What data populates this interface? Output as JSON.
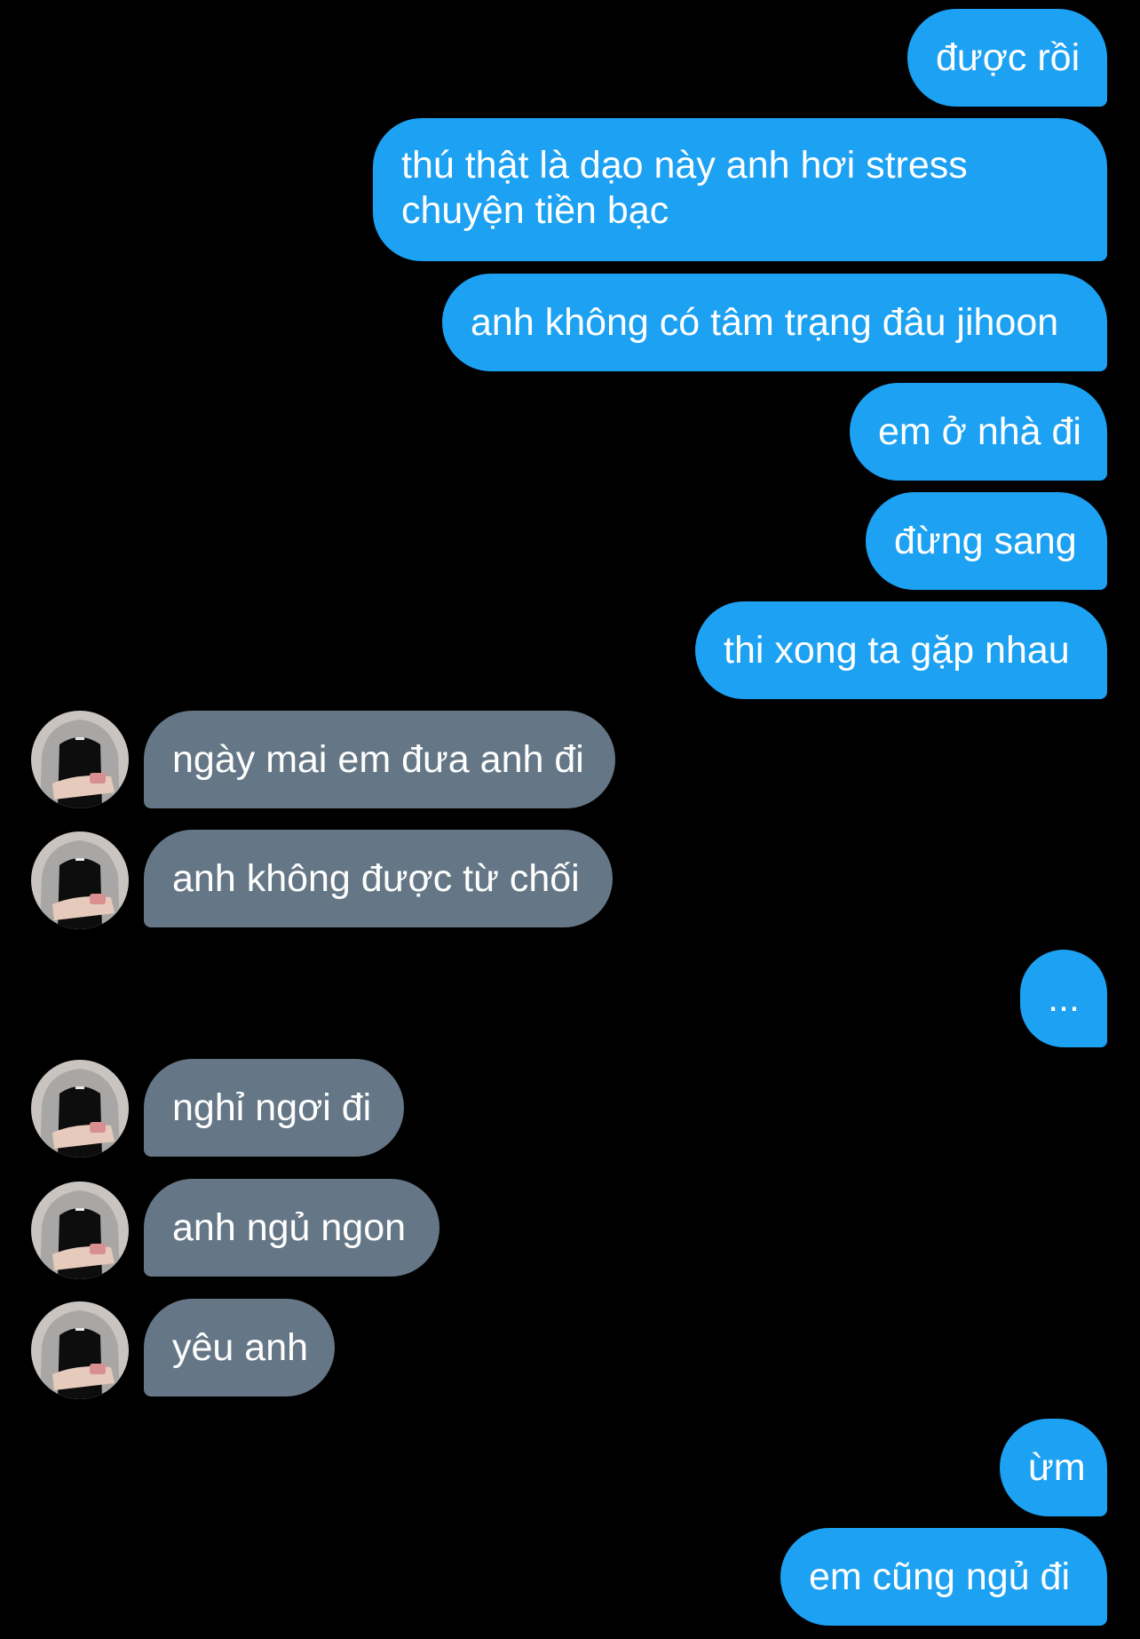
{
  "conversation": {
    "messages": [
      {
        "side": "out",
        "text": "được rồi"
      },
      {
        "side": "out",
        "text": "thú thật là dạo này anh hơi stress chuyện tiền bạc"
      },
      {
        "side": "out",
        "text": "anh không có tâm trạng đâu jihoon"
      },
      {
        "side": "out",
        "text": "em ở nhà đi"
      },
      {
        "side": "out",
        "text": "đừng sang"
      },
      {
        "side": "out",
        "text": "thi xong ta gặp nhau"
      },
      {
        "side": "in",
        "text": "ngày mai em đưa anh đi"
      },
      {
        "side": "in",
        "text": "anh không được từ chối"
      },
      {
        "side": "out",
        "text": "..."
      },
      {
        "side": "in",
        "text": "nghỉ ngơi đi"
      },
      {
        "side": "in",
        "text": "anh ngủ ngon"
      },
      {
        "side": "in",
        "text": "yêu anh"
      },
      {
        "side": "out",
        "text": "ừm"
      },
      {
        "side": "out",
        "text": "em cũng ngủ đi"
      }
    ]
  },
  "colors": {
    "background": "#000000",
    "outgoing_bubble": "#1da1f2",
    "incoming_bubble": "#657786",
    "text": "#ffffff"
  },
  "icons": {
    "avatar": "contact-avatar-photo"
  }
}
